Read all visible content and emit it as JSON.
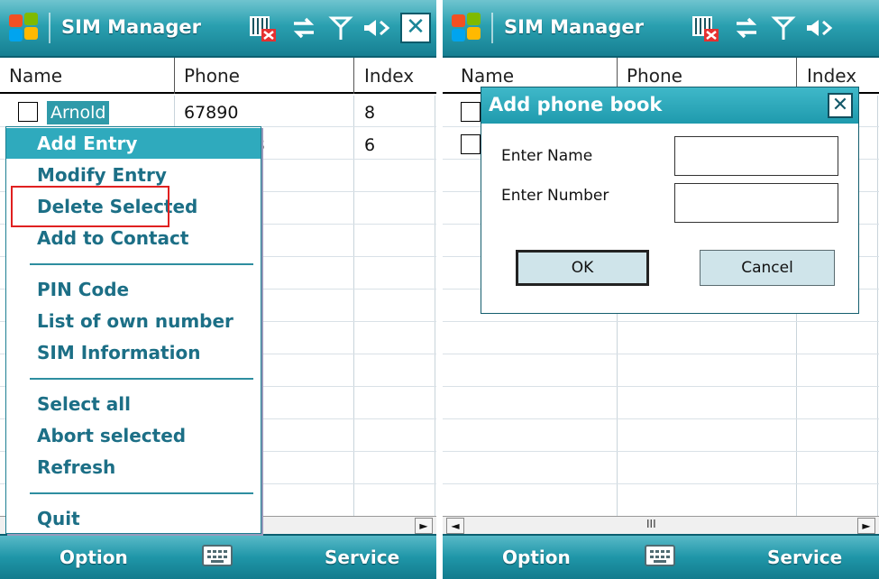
{
  "left": {
    "title": "SIM Manager",
    "columns": [
      "Name",
      "Phone",
      "Index"
    ],
    "rows": [
      {
        "name": "Arnold",
        "phone": "67890",
        "index": "8"
      },
      {
        "name": "",
        "phone": "3",
        "index": "6"
      }
    ],
    "menu": {
      "items": [
        {
          "label": "Add Entry",
          "highlighted": true
        },
        {
          "label": "Modify Entry"
        },
        {
          "label": "Delete Selected"
        },
        {
          "label": "Add to Contact"
        },
        {
          "label": "PIN Code"
        },
        {
          "label": "List of own number"
        },
        {
          "label": "SIM Information"
        },
        {
          "label": "Select all"
        },
        {
          "label": "Abort selected"
        },
        {
          "label": "Refresh"
        },
        {
          "label": "Quit"
        }
      ]
    },
    "softkeys": {
      "left": "Option",
      "right": "Service"
    }
  },
  "right": {
    "title": "SIM Manager",
    "columns": [
      "Name",
      "Phone",
      "Index"
    ],
    "dialog": {
      "title": "Add phone book",
      "name_label": "Enter Name",
      "number_label": "Enter Number",
      "name_value": "",
      "number_value": "",
      "ok_label": "OK",
      "cancel_label": "Cancel"
    },
    "scroll_thumb": "III",
    "softkeys": {
      "left": "Option",
      "right": "Service"
    }
  },
  "icons": [
    "windows-logo-icon",
    "sim-error-icon",
    "sync-arrows-icon",
    "signal-antenna-icon",
    "speaker-muted-icon",
    "close-icon",
    "keyboard-icon"
  ],
  "colors": {
    "titlebar": "#2aa0b0",
    "menu_text": "#1c6f86",
    "highlight": "#2faabd",
    "red_annotation": "#e02020"
  }
}
